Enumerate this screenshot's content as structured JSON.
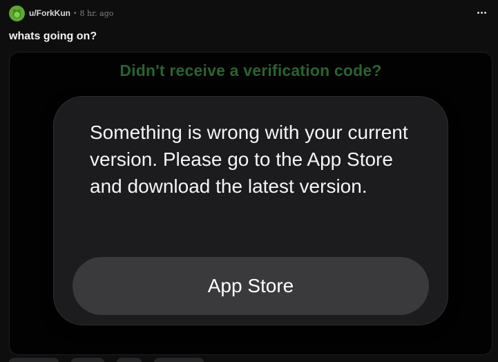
{
  "post": {
    "author": "u/ForkKun",
    "separator": "•",
    "timestamp": "8 hr. ago",
    "title": "whats going on?",
    "avatar_icon": "snoo-avatar-icon",
    "more_icon": "more-options-icon"
  },
  "media": {
    "background_text": "Didn't receive a verification code?",
    "alert": {
      "message": "Something is wrong with your current version. Please go to the App Store and download the latest version.",
      "button_label": "App Store"
    }
  },
  "colors": {
    "avatar": "#5fa832",
    "background_text": "#2a6330",
    "alert_bg": "#1c1c1e",
    "alert_button_bg": "#3a3a3c"
  }
}
